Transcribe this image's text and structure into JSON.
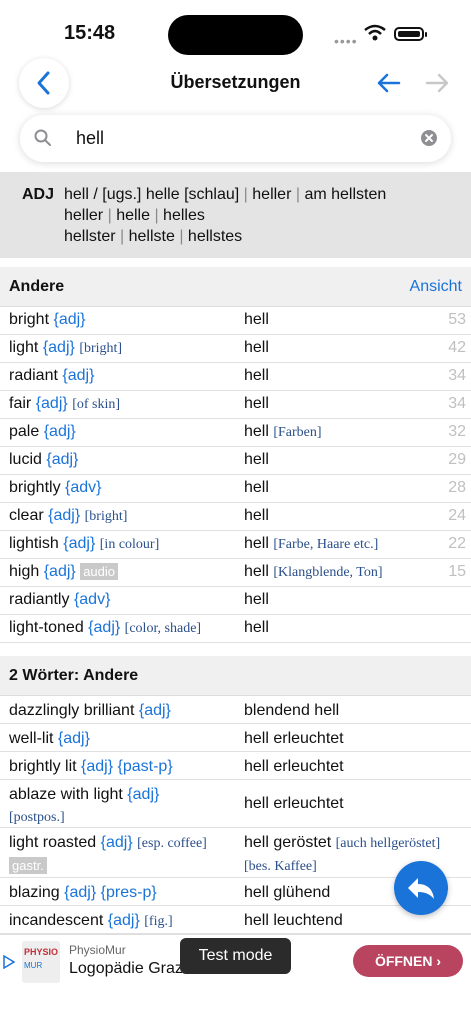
{
  "status": {
    "time": "15:48"
  },
  "nav": {
    "title": "Übersetzungen"
  },
  "search": {
    "query": "hell"
  },
  "adj": {
    "label": "ADJ",
    "line1": [
      "hell / [ugs.] helle [schlau]",
      "heller",
      "am hellsten"
    ],
    "line2": [
      "heller",
      "helle",
      "helles"
    ],
    "line3": [
      "hellster",
      "hellste",
      "hellstes"
    ]
  },
  "sections": [
    {
      "title": "Andere",
      "link": "Ansicht"
    },
    {
      "title": "2 Wörter: Andere"
    }
  ],
  "rows1": [
    {
      "word": "bright",
      "tag": "{adj}",
      "note": "",
      "badge": "",
      "de": "hell",
      "de_note": "",
      "count": "53"
    },
    {
      "word": "light",
      "tag": "{adj}",
      "note": "[bright]",
      "badge": "",
      "de": "hell",
      "de_note": "",
      "count": "42"
    },
    {
      "word": "radiant",
      "tag": "{adj}",
      "note": "",
      "badge": "",
      "de": "hell",
      "de_note": "",
      "count": "34"
    },
    {
      "word": "fair",
      "tag": "{adj}",
      "note": "[of skin]",
      "badge": "",
      "de": "hell",
      "de_note": "",
      "count": "34"
    },
    {
      "word": "pale",
      "tag": "{adj}",
      "note": "",
      "badge": "",
      "de": "hell",
      "de_note": "[Farben]",
      "count": "32"
    },
    {
      "word": "lucid",
      "tag": "{adj}",
      "note": "",
      "badge": "",
      "de": "hell",
      "de_note": "",
      "count": "29"
    },
    {
      "word": "brightly",
      "tag": "{adv}",
      "note": "",
      "badge": "",
      "de": "hell",
      "de_note": "",
      "count": "28"
    },
    {
      "word": "clear",
      "tag": "{adj}",
      "note": "[bright]",
      "badge": "",
      "de": "hell",
      "de_note": "",
      "count": "24"
    },
    {
      "word": "lightish",
      "tag": "{adj}",
      "note": "[in colour]",
      "badge": "",
      "de": "hell",
      "de_note": "[Farbe, Haare etc.]",
      "count": "22"
    },
    {
      "word": "high",
      "tag": "{adj}",
      "note": "",
      "badge": "audio",
      "de": "hell",
      "de_note": "[Klangblende, Ton]",
      "count": "15"
    },
    {
      "word": "radiantly",
      "tag": "{adv}",
      "note": "",
      "badge": "",
      "de": "hell",
      "de_note": "",
      "count": ""
    },
    {
      "word": "light-toned",
      "tag": "{adj}",
      "note": "[color, shade]",
      "badge": "",
      "de": "hell",
      "de_note": "",
      "count": ""
    }
  ],
  "rows2": [
    {
      "word": "dazzlingly brilliant",
      "tag": "{adj}",
      "de": "blendend hell"
    },
    {
      "word": "well-lit",
      "tag": "{adj}",
      "de": "hell erleuchtet"
    },
    {
      "word": "brightly lit",
      "tag": "{adj} {past-p}",
      "de": "hell erleuchtet"
    },
    {
      "word": "ablaze with light",
      "tag": "{adj}",
      "note2": "[postpos.]",
      "de": "hell erleuchtet"
    },
    {
      "word": "light roasted",
      "tag": "{adj}",
      "note": "[esp. coffee]",
      "badge2": "gastr.",
      "de": "hell geröstet",
      "de_note": "[auch hellgeröstet]",
      "de_note2": "[bes. Kaffee]"
    },
    {
      "word": "blazing",
      "tag": "{adj} {pres-p}",
      "de": "hell glühend"
    },
    {
      "word": "incandescent",
      "tag": "{adj}",
      "note": "[fig.]",
      "de": "hell leuchtend"
    }
  ],
  "ad": {
    "brand": "PhysioMur",
    "title": "Logopädie Graz",
    "button": "ÖFFNEN ›",
    "logo_top": "PHYSIO",
    "logo_bottom": "MUR"
  },
  "toast": "Test mode",
  "colors": {
    "accent": "#1a73d9",
    "ad_button": "#b8445f"
  }
}
